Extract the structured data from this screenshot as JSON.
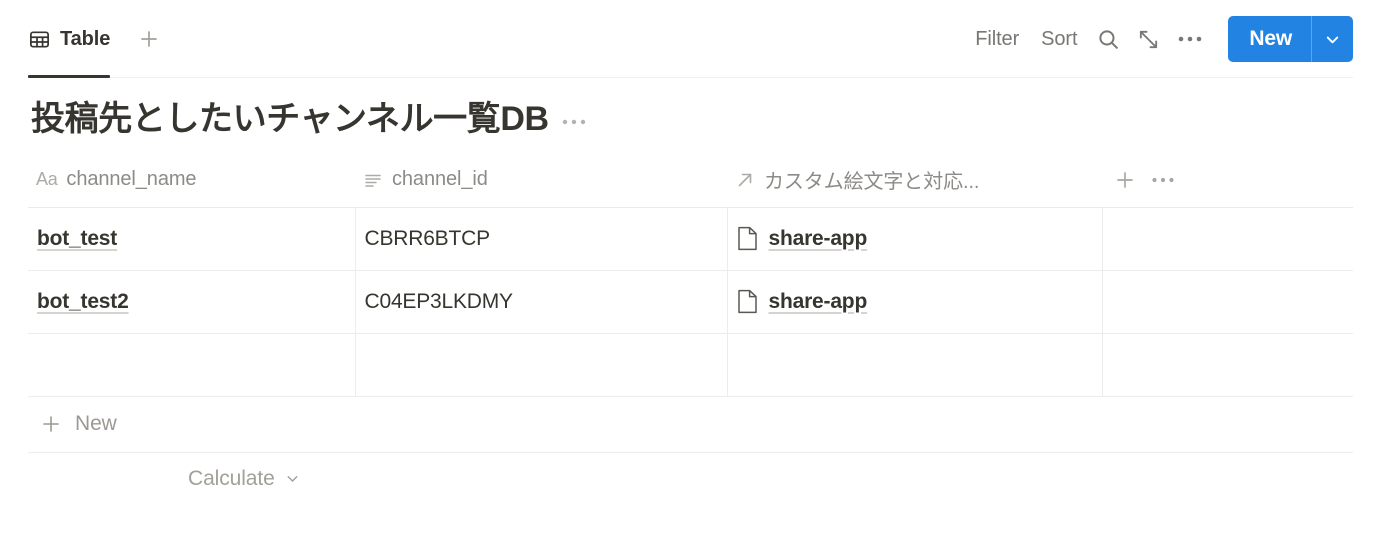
{
  "viewbar": {
    "tabs": [
      {
        "label": "Table",
        "icon": "table-icon",
        "active": true
      }
    ],
    "add_view_label": "+",
    "toolbar": {
      "filter_label": "Filter",
      "sort_label": "Sort",
      "search_icon": "search-icon",
      "expand_icon": "expand-diagonal-icon",
      "more_icon": "ellipsis-icon",
      "new_label": "New",
      "new_caret_icon": "chevron-down-icon",
      "accent_color": "#2383e2"
    }
  },
  "header": {
    "title": "投稿先としたいチャンネル一覧DB",
    "title_menu_icon": "ellipsis-icon"
  },
  "table": {
    "columns": [
      {
        "key": "channel_name",
        "label": "channel_name",
        "prop_icon": "title-aa-icon"
      },
      {
        "key": "channel_id",
        "label": "channel_id",
        "prop_icon": "text-lines-icon"
      },
      {
        "key": "relation",
        "label": "カスタム絵文字と対応...",
        "prop_icon": "relation-arrow-icon"
      }
    ],
    "header_actions": {
      "add_property_icon": "plus-icon",
      "more_icon": "ellipsis-icon"
    },
    "rows": [
      {
        "channel_name": "bot_test",
        "channel_id": "CBRR6BTCP",
        "relation": [
          {
            "label": "share-app",
            "icon": "page-icon"
          }
        ]
      },
      {
        "channel_name": "bot_test2",
        "channel_id": "C04EP3LKDMY",
        "relation": [
          {
            "label": "share-app",
            "icon": "page-icon"
          }
        ]
      },
      {
        "channel_name": "",
        "channel_id": "",
        "relation": []
      }
    ],
    "footer": {
      "new_row_label": "New",
      "new_row_icon": "plus-icon",
      "calculate_label": "Calculate",
      "calculate_caret_icon": "chevron-down-icon"
    }
  }
}
